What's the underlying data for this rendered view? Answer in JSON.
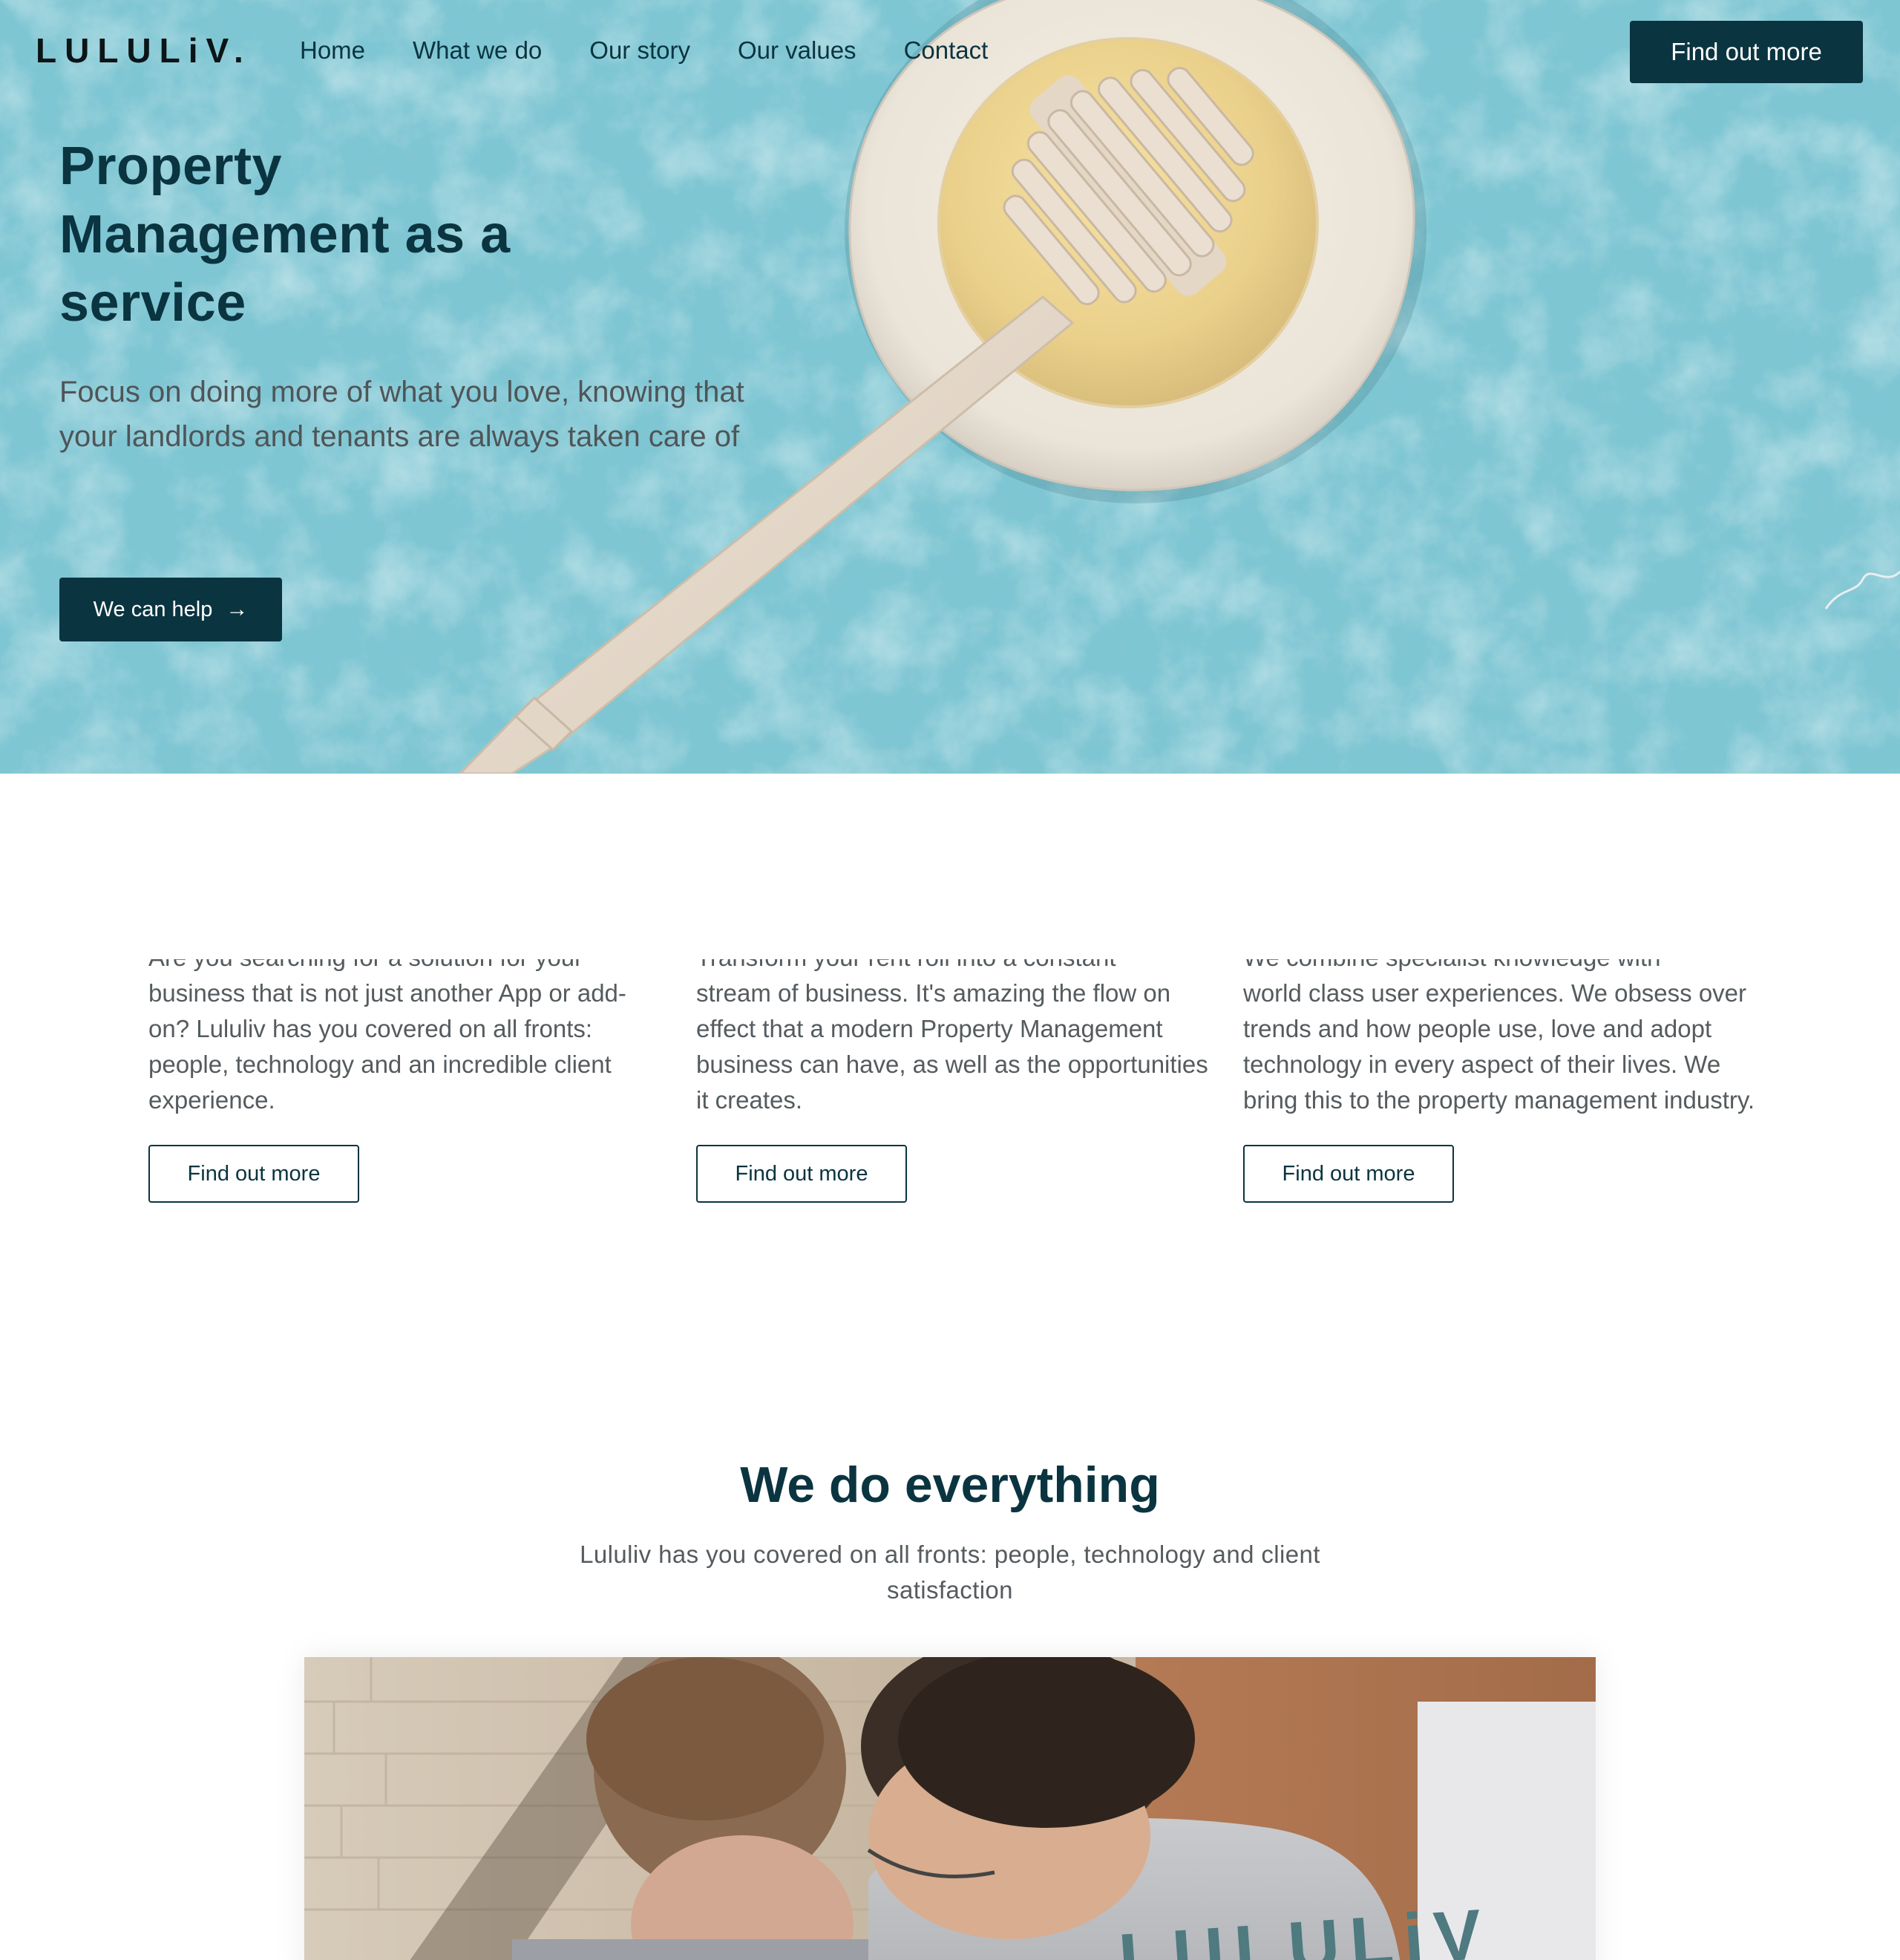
{
  "brand": {
    "logo_text": "LULULiV."
  },
  "nav": {
    "links": [
      "Home",
      "What we do",
      "Our story",
      "Our values",
      "Contact"
    ],
    "cta_label": "Find out more"
  },
  "hero": {
    "title": "Property Management as a service",
    "subtitle": "Focus on doing more of what you love, knowing that your landlords and tenants are always taken care of",
    "cta_label": "We can help",
    "cta_icon": "arrow-right-icon",
    "background_color": "#7ec6d3"
  },
  "features": [
    {
      "partial_first_line": "Are you searching for a solution for your",
      "text": "business that is not just another App or add-on? Lululiv has you covered on all fronts: people, technology and an incredible client experience.",
      "button_label": "Find out more"
    },
    {
      "partial_first_line": "Transform your rent roll into a constant",
      "text": "stream of business. It's amazing the flow on effect that a modern Property Management business can have, as well as the opportunities it creates.",
      "button_label": "Find out more"
    },
    {
      "partial_first_line": "We combine specialist knowledge with",
      "text": "world class user experiences. We obsess over trends and how people use, love and adopt technology in every aspect of their lives. We bring this to the property management industry.",
      "button_label": "Find out more"
    }
  ],
  "everything": {
    "title": "We do everything",
    "subtitle": "Lululiv has you covered on all fronts: people, technology and client satisfaction",
    "photo_shirt_text": "LULULiV"
  },
  "colors": {
    "primary": "#0a3440",
    "hero_bg": "#7ec6d3",
    "body_text": "#555b5e"
  }
}
